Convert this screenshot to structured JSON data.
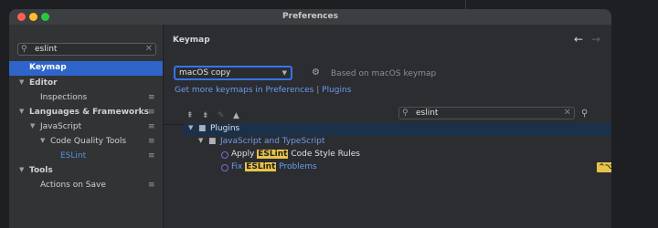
{
  "window": {
    "title": "Preferences"
  },
  "sidebar": {
    "search": {
      "value": "eslint"
    },
    "items": [
      {
        "label": "Keymap"
      },
      {
        "label": "Editor"
      },
      {
        "label": "Inspections"
      },
      {
        "label": "Languages & Frameworks"
      },
      {
        "label": "JavaScript"
      },
      {
        "label": "Code Quality Tools"
      },
      {
        "label": "ESLint"
      },
      {
        "label": "Tools"
      },
      {
        "label": "Actions on Save"
      }
    ]
  },
  "main": {
    "title": "Keymap",
    "keymap_select": {
      "value": "macOS copy"
    },
    "based_on": "Based on macOS keymap",
    "links": {
      "text1": "Get more keymaps in Preferences",
      "sep": "|",
      "text2": "Plugins"
    },
    "search": {
      "value": "eslint"
    },
    "tree": {
      "plugins": "Plugins",
      "js_ts": "JavaScript and TypeScript",
      "action1": {
        "prefix": "Apply ",
        "highlight": "ESLint",
        "suffix": " Code Style Rules"
      },
      "action2": {
        "prefix": "Fix ",
        "highlight": "ESLint",
        "suffix": " Problems",
        "shortcut": "^⌥L"
      }
    }
  },
  "colors": {
    "accent": "#3574f0",
    "selection": "#2f65ca",
    "highlight": "#e8c34a",
    "link": "#6c9bf0"
  },
  "icons": {
    "toolbar": [
      "expand-all-icon",
      "collapse-all-icon",
      "edit-icon",
      "warning-icon"
    ],
    "settings": "gear-icon",
    "find_by_shortcut": "find-shortcut-icon"
  }
}
